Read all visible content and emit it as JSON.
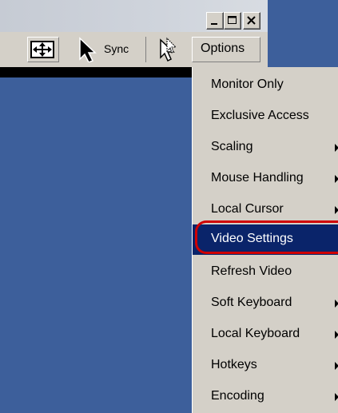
{
  "window": {
    "buttons": [
      {
        "name": "minimize-button",
        "icon": "minimize-icon"
      },
      {
        "name": "maximize-button",
        "icon": "maximize-icon"
      },
      {
        "name": "close-button",
        "icon": "close-icon"
      }
    ]
  },
  "toolbar": {
    "fit_icon": "fit-screen-icon",
    "arrow_icon": "mouse-arrow-icon",
    "sync_label": "Sync",
    "cursor_icon": "single-cursor-icon",
    "options_label": "Options"
  },
  "menu": {
    "items": [
      {
        "label": "Monitor Only",
        "submenu": false
      },
      {
        "label": "Exclusive Access",
        "submenu": false
      },
      {
        "label": "Scaling",
        "submenu": true
      },
      {
        "label": "Mouse Handling",
        "submenu": true
      },
      {
        "label": "Local Cursor",
        "submenu": true
      },
      {
        "label": "Video Settings",
        "submenu": false,
        "selected": true
      },
      {
        "label": "Refresh Video",
        "submenu": false
      },
      {
        "label": "Soft Keyboard",
        "submenu": true
      },
      {
        "label": "Local Keyboard",
        "submenu": true
      },
      {
        "label": "Hotkeys",
        "submenu": true
      },
      {
        "label": "Encoding",
        "submenu": true
      }
    ]
  },
  "colors": {
    "desktop": "#3d5f9b",
    "selection": "#0a246a",
    "highlight_ring": "#d00000",
    "menu_bg": "#d4d0c8"
  }
}
